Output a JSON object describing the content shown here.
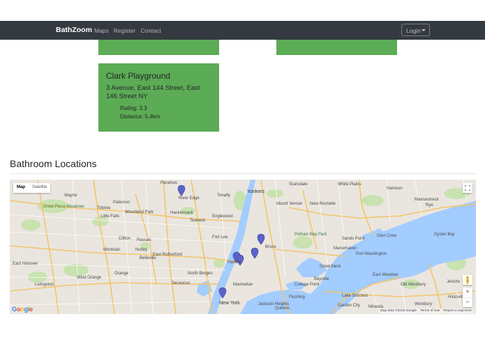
{
  "navbar": {
    "brand": "BathZoom",
    "links": [
      "Maps",
      "Register",
      "Contact"
    ],
    "login_label": "Login"
  },
  "card": {
    "title": "Clark Playground",
    "address": "3 Avenue, East 144 Street, East 146 Street NY",
    "rating": "Rating: 3.3",
    "distance": "Distance: 5.4km"
  },
  "colors": {
    "navbar_bg": "#343a40",
    "card_bg": "#5cab55",
    "map_water": "#a3ccff",
    "map_land": "#e8e4dc",
    "marker": "#5b63c7"
  },
  "section": {
    "title": "Bathroom Locations"
  },
  "map": {
    "type_buttons": [
      "Map",
      "Satellite"
    ],
    "zoom_in": "+",
    "zoom_out": "−",
    "logo": "Google",
    "attribution": [
      "Map data ©2018 Google",
      "Terms of Use",
      "Report a map error"
    ],
    "marker_count": 6,
    "place_labels": [
      "Paramus",
      "River Edge",
      "Yonkers",
      "Mount Vernon",
      "New Rochelle",
      "Wayne",
      "Great Piece Meadows",
      "Paterson",
      "Totowa",
      "Hackensack",
      "Teaneck",
      "Englewood",
      "Tenafly",
      "Little Falls",
      "Woodland Park",
      "Clifton",
      "Passaic",
      "Fort Lee",
      "Montclair",
      "Nutley",
      "Belleville",
      "East Rutherford",
      "North Bergen",
      "East Hanover",
      "West Orange",
      "Livingston",
      "Orange",
      "Secaucus",
      "Harlem",
      "Bronx",
      "Pelham Bay Park",
      "Sands Point",
      "Manorhaven",
      "Port Washington",
      "Great Neck",
      "Glen Cove",
      "Oyster Bay",
      "Mamaroneck",
      "Rye",
      "Harrison",
      "White Plains",
      "Scarsdale",
      "Lake Success",
      "Hicksville",
      "Westbury",
      "Jericho",
      "Old Westbury",
      "East Meadow",
      "College Point",
      "Bayside",
      "Jackson Heights",
      "Flushing",
      "Queens",
      "New York",
      "Manhattan",
      "Mineola",
      "Garden City"
    ]
  }
}
